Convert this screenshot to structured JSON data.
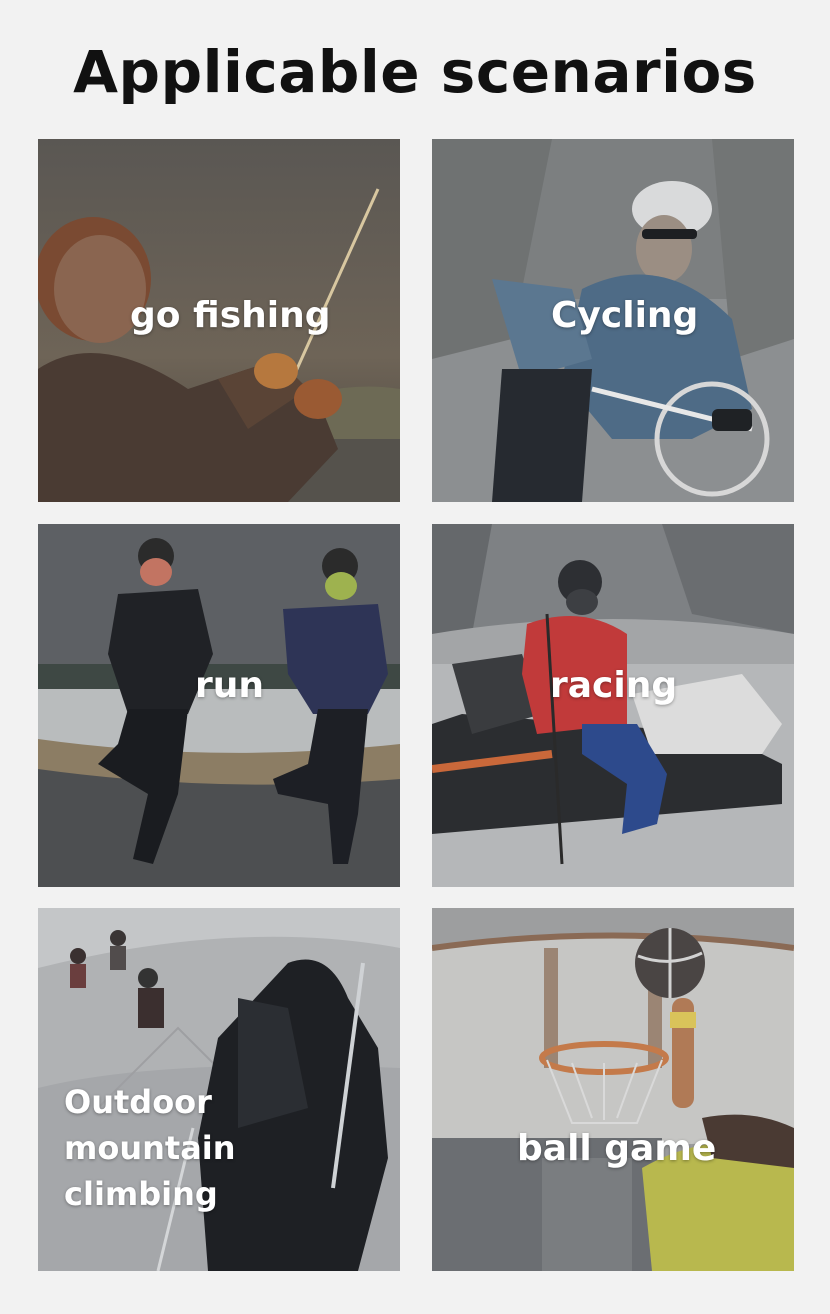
{
  "title": "Applicable scenarios",
  "scenarios": [
    {
      "label": "go fishing",
      "icon": "fishing-photo"
    },
    {
      "label": "Cycling",
      "icon": "cycling-photo"
    },
    {
      "label": "run",
      "icon": "running-photo"
    },
    {
      "label": "racing",
      "icon": "snowmobile-photo"
    },
    {
      "label": "Outdoor\nmountain climbing",
      "icon": "climbing-photo"
    },
    {
      "label": "ball game",
      "icon": "basketball-photo"
    }
  ]
}
